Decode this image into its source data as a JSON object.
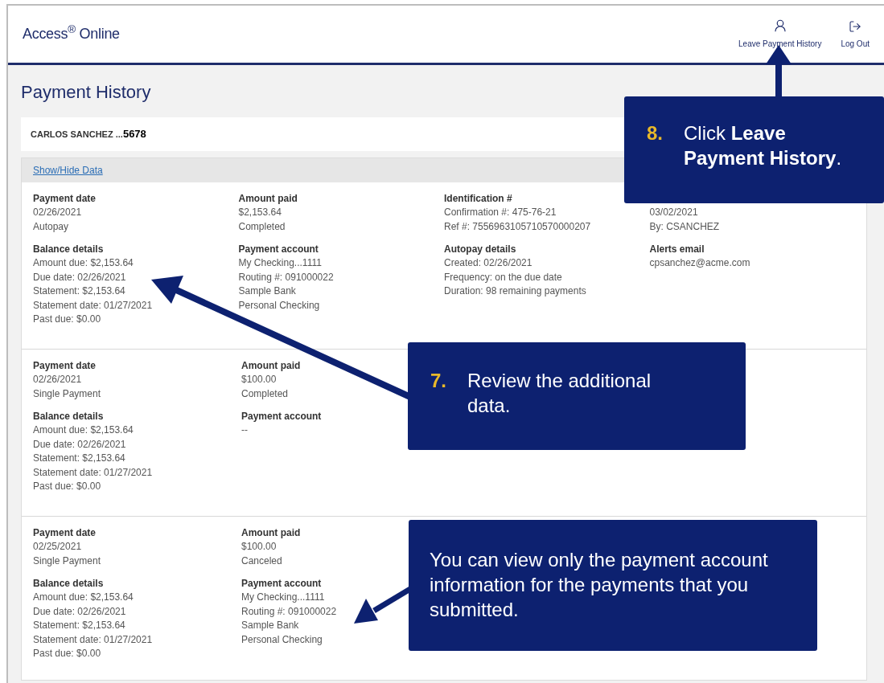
{
  "header": {
    "logo": "Access$^{®}$ Online",
    "actions": [
      {
        "kind": "profile",
        "label": "Leave Payment History"
      },
      {
        "kind": "logout",
        "label": "Log Out"
      }
    ]
  },
  "title": "Payment History",
  "account": {
    "name": "CARLOS SANCHEZ ...",
    "number": "5678"
  },
  "toggle_link": "Show/Hide Data",
  "rows": [
    {
      "columns": [
        [
          {
            "heading": "Payment date",
            "lines": [
              "02/26/2021",
              "Autopay"
            ]
          },
          {
            "heading": "Balance details",
            "lines": [
              "Amount due: $2,153.64",
              "Due date: 02/26/2021",
              "Statement: $2,153.64",
              "Statement date: 01/27/2021",
              "Past due: $0.00"
            ]
          }
        ],
        [
          {
            "heading": "Amount paid",
            "lines": [
              "$2,153.64",
              "Completed"
            ]
          },
          {
            "heading": "Payment account",
            "lines": [
              "My Checking...1111",
              "Routing #: 091000022",
              "Sample Bank",
              "Personal Checking"
            ]
          }
        ],
        [
          {
            "heading": "Identification #",
            "lines": [
              "Confirmation #: 475-76-21",
              "Ref #: 7556963105710570000207"
            ]
          },
          {
            "heading": "Autopay details",
            "lines": [
              "Created: 02/26/2021",
              "Frequency: on the due date",
              "Duration: 98 remaining payments"
            ]
          }
        ],
        [
          {
            "lines": [
              "03/02/2021",
              "By: CSANCHEZ"
            ]
          },
          {
            "heading": "Alerts email",
            "lines": [
              "cpsanchez@acme.com"
            ]
          }
        ]
      ]
    },
    {
      "columns": [
        [
          {
            "heading": "Payment date",
            "lines": [
              "02/26/2021",
              "Single Payment"
            ]
          },
          {
            "heading": "Balance details",
            "lines": [
              "Amount due: $2,153.64",
              "Due date: 02/26/2021",
              "Statement: $2,153.64",
              "Statement date: 01/27/2021",
              "Past due: $0.00"
            ]
          }
        ],
        [
          {
            "heading": "Amount paid",
            "lines": [
              "$100.00",
              "Completed"
            ]
          },
          {
            "heading": "Payment account",
            "lines": [
              "--"
            ]
          }
        ]
      ]
    },
    {
      "columns": [
        [
          {
            "heading": "Payment date",
            "lines": [
              "02/25/2021",
              "Single Payment"
            ]
          },
          {
            "heading": "Balance details",
            "lines": [
              "Amount due: $2,153.64",
              "Due date: 02/26/2021",
              "Statement: $2,153.64",
              "Statement date: 01/27/2021",
              "Past due: $0.00"
            ]
          }
        ],
        [
          {
            "heading": "Amount paid",
            "lines": [
              "$100.00",
              "Canceled"
            ]
          },
          {
            "heading": "Payment account",
            "lines": [
              "My Checking...1111",
              "Routing #: 091000022",
              "Sample Bank",
              "Personal Checking"
            ]
          }
        ]
      ]
    }
  ],
  "callouts": [
    {
      "number": "8.",
      "text": "Click **Leave Payment History**."
    },
    {
      "number": "7.",
      "text": "Review the additional data."
    },
    {
      "text": "You can view only the payment account information for the payments that you submitted."
    }
  ]
}
